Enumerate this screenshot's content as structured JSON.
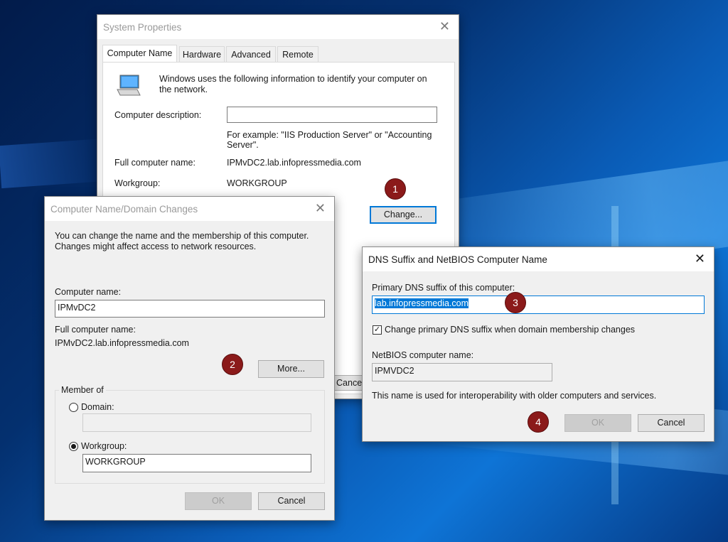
{
  "system_properties": {
    "title": "System Properties",
    "tabs": [
      "Computer Name",
      "Hardware",
      "Advanced",
      "Remote"
    ],
    "intro": "Windows uses the following information to identify your computer on the network.",
    "description_label": "Computer description:",
    "description_value": "",
    "example": "For example: \"IIS Production Server\" or \"Accounting Server\".",
    "full_name_label": "Full computer name:",
    "full_name_value": "IPMvDC2.lab.infopressmedia.com",
    "workgroup_label": "Workgroup:",
    "workgroup_value": "WORKGROUP",
    "change_button": "Change...",
    "cancel_button_partial": "Cancel"
  },
  "name_changes": {
    "title": "Computer Name/Domain Changes",
    "intro": "You can change the name and the membership of this computer. Changes might affect access to network resources.",
    "computer_name_label": "Computer name:",
    "computer_name_value": "IPMvDC2",
    "full_name_label": "Full computer name:",
    "full_name_value": "IPMvDC2.lab.infopressmedia.com",
    "more_button": "More...",
    "member_of_label": "Member of",
    "domain_label": "Domain:",
    "domain_value": "",
    "workgroup_label": "Workgroup:",
    "workgroup_value": "WORKGROUP",
    "ok_button": "OK",
    "cancel_button": "Cancel"
  },
  "dns_suffix": {
    "title": "DNS Suffix and NetBIOS Computer Name",
    "primary_label": "Primary DNS suffix of this computer:",
    "primary_value": "lab.infopressmedia.com",
    "checkbox_label": "Change primary DNS suffix when domain membership changes",
    "checkbox_checked": true,
    "netbios_label": "NetBIOS computer name:",
    "netbios_value": "IPMVDC2",
    "note": "This name is used for interoperability with older computers and services.",
    "ok_button": "OK",
    "cancel_button": "Cancel"
  },
  "badges": [
    "1",
    "2",
    "3",
    "4"
  ],
  "colors": {
    "badge": "#8b1a1a",
    "accent": "#0078d7"
  }
}
